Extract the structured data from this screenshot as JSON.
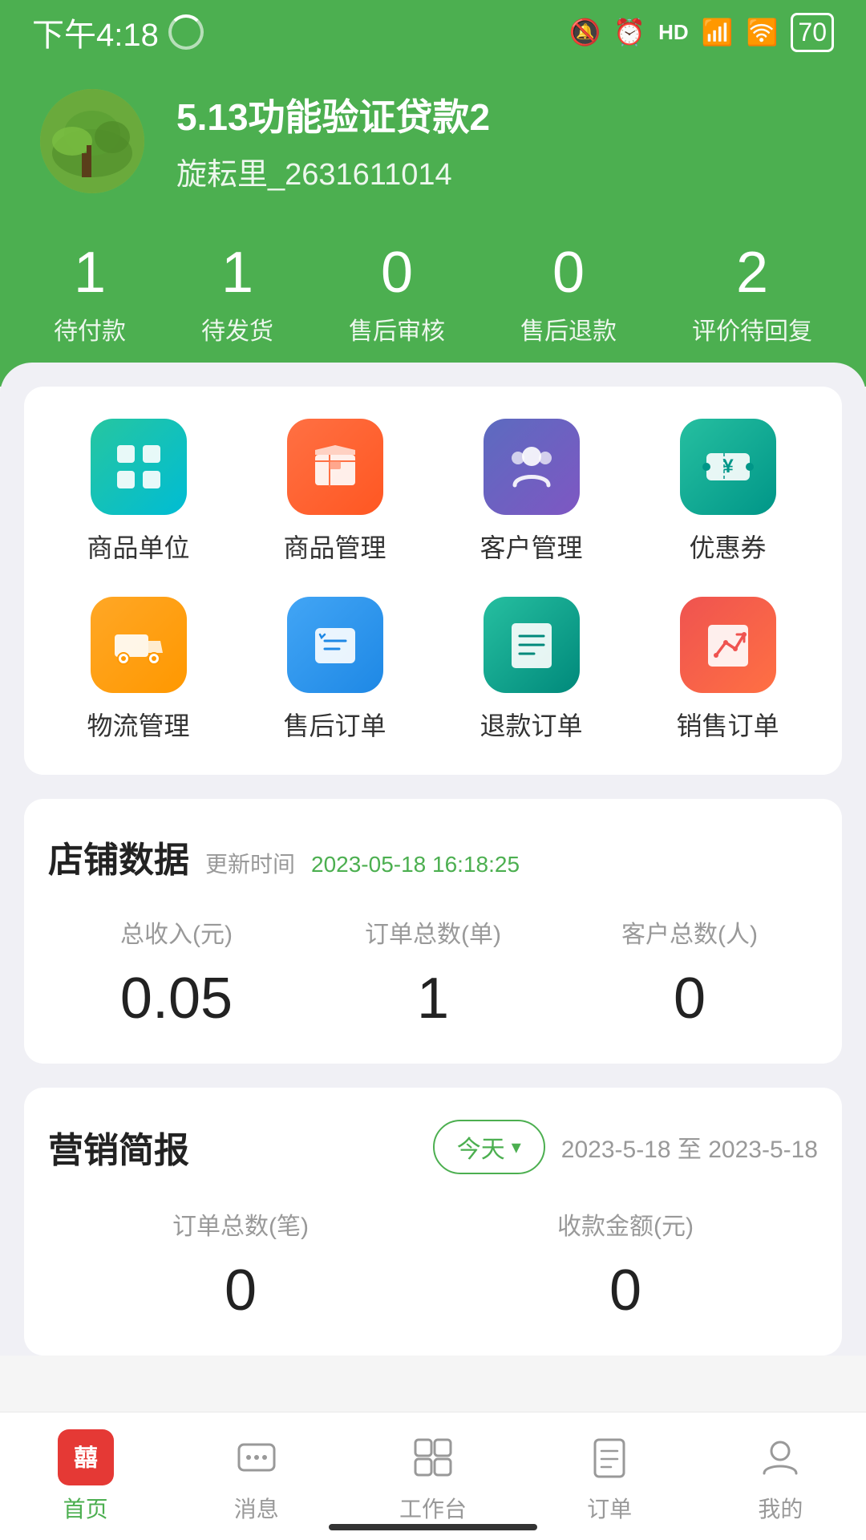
{
  "statusBar": {
    "time": "下午4:18",
    "battery": "70"
  },
  "profile": {
    "name": "5.13功能验证贷款2",
    "id": "旋耘里_2631611014"
  },
  "orderStats": [
    {
      "num": "1",
      "label": "待付款"
    },
    {
      "num": "1",
      "label": "待发货"
    },
    {
      "num": "0",
      "label": "售后审核"
    },
    {
      "num": "0",
      "label": "售后退款"
    },
    {
      "num": "2",
      "label": "评价待回复"
    }
  ],
  "quickActions": [
    {
      "label": "商品单位",
      "colorClass": "bg-teal",
      "icon": "grid"
    },
    {
      "label": "商品管理",
      "colorClass": "bg-orange",
      "icon": "box"
    },
    {
      "label": "客户管理",
      "colorClass": "bg-blue-purple",
      "icon": "users"
    },
    {
      "label": "优惠券",
      "colorClass": "bg-teal2",
      "icon": "coupon"
    },
    {
      "label": "物流管理",
      "colorClass": "bg-yellow",
      "icon": "truck"
    },
    {
      "label": "售后订单",
      "colorClass": "bg-blue",
      "icon": "refund"
    },
    {
      "label": "退款订单",
      "colorClass": "bg-teal3",
      "icon": "receipt"
    },
    {
      "label": "销售订单",
      "colorClass": "bg-red-orange",
      "icon": "sales"
    }
  ],
  "storeData": {
    "title": "店铺数据",
    "updateLabel": "更新时间",
    "updateTime": "2023-05-18 16:18:25",
    "cols": [
      {
        "label": "总收入(元)",
        "value": "0.05"
      },
      {
        "label": "订单总数(单)",
        "value": "1"
      },
      {
        "label": "客户总数(人)",
        "value": "0"
      }
    ]
  },
  "marketing": {
    "title": "营销简报",
    "todayBtn": "今天",
    "dateRange": "2023-5-18 至 2023-5-18",
    "cols": [
      {
        "label": "订单总数(笔)",
        "value": "0"
      },
      {
        "label": "收款金额(元)",
        "value": "0"
      }
    ]
  },
  "bottomNav": [
    {
      "label": "首页",
      "active": true,
      "icon": "home"
    },
    {
      "label": "消息",
      "active": false,
      "icon": "message"
    },
    {
      "label": "工作台",
      "active": false,
      "icon": "workbench"
    },
    {
      "label": "订单",
      "active": false,
      "icon": "order"
    },
    {
      "label": "我的",
      "active": false,
      "icon": "profile"
    }
  ]
}
